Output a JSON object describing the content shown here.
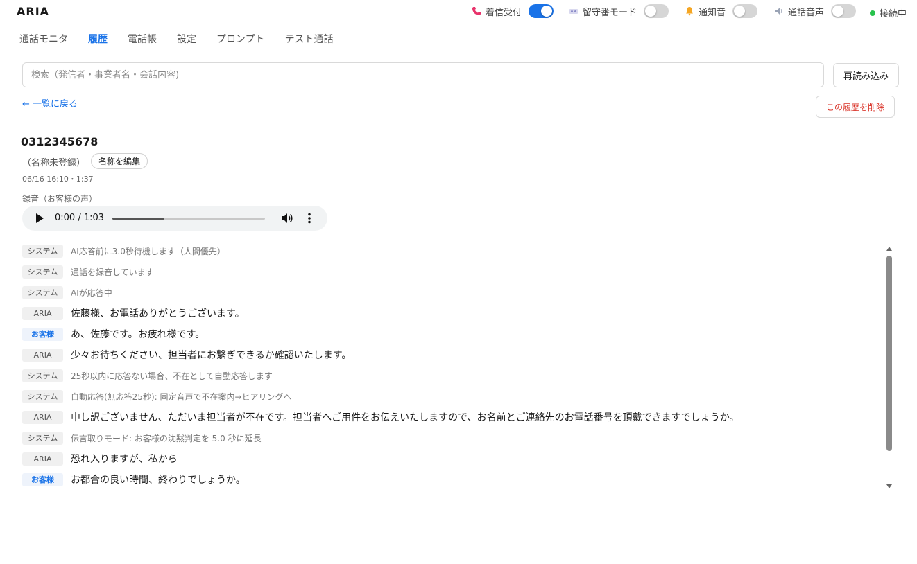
{
  "app": {
    "title": "ARIA"
  },
  "status": {
    "incoming": {
      "label": "着信受付",
      "on": true,
      "icon": "phone-icon",
      "color": "#e8336b"
    },
    "voicemail": {
      "label": "留守番モード",
      "on": false,
      "icon": "voicemail-icon"
    },
    "notify": {
      "label": "通知音",
      "on": false,
      "icon": "bell-icon",
      "color": "#f5a623"
    },
    "callaudio": {
      "label": "通話音声",
      "on": false,
      "icon": "speaker-icon"
    },
    "connection": {
      "label": "接続中",
      "color": "#27c24c"
    }
  },
  "tabs": [
    {
      "label": "通話モニタ",
      "active": false
    },
    {
      "label": "履歴",
      "active": true
    },
    {
      "label": "電話帳",
      "active": false
    },
    {
      "label": "設定",
      "active": false
    },
    {
      "label": "プロンプト",
      "active": false
    },
    {
      "label": "テスト通話",
      "active": false
    }
  ],
  "search": {
    "placeholder": "検索（発信者・事業者名・会話内容)",
    "value": ""
  },
  "buttons": {
    "reload": "再読み込み",
    "back": "← 一覧に戻る",
    "delete": "この履歴を削除",
    "edit_name": "名称を編集"
  },
  "call": {
    "number": "0312345678",
    "name": "（名称未登録）",
    "meta": "06/16 16:10・1:37",
    "recording_label": "録音（お客様の声）",
    "player": {
      "time": "0:00 / 1:03",
      "progress": 0.34
    }
  },
  "transcript": [
    {
      "speaker": "system",
      "badge": "システム",
      "text": "AI応答前に3.0秒待機します（人間優先）"
    },
    {
      "speaker": "system",
      "badge": "システム",
      "text": "通話を録音しています"
    },
    {
      "speaker": "system",
      "badge": "システム",
      "text": "AIが応答中"
    },
    {
      "speaker": "aria",
      "badge": "ARIA",
      "text": "佐藤様、お電話ありがとうございます。"
    },
    {
      "speaker": "customer",
      "badge": "お客様",
      "text": "あ、佐藤です。お疲れ様です。"
    },
    {
      "speaker": "aria",
      "badge": "ARIA",
      "text": "少々お待ちください、担当者にお繋ぎできるか確認いたします。"
    },
    {
      "speaker": "system",
      "badge": "システム",
      "text": "25秒以内に応答ない場合、不在として自動応答します"
    },
    {
      "speaker": "system",
      "badge": "システム",
      "text": "自動応答(無応答25秒): 固定音声で不在案内→ヒアリングへ"
    },
    {
      "speaker": "aria",
      "badge": "ARIA",
      "text": "申し訳ございません、ただいま担当者が不在です。担当者へご用件をお伝えいたしますので、お名前とご連絡先のお電話番号を頂戴できますでしょうか。"
    },
    {
      "speaker": "system",
      "badge": "システム",
      "text": "伝言取りモード: お客様の沈黙判定を 5.0 秒に延長"
    },
    {
      "speaker": "aria",
      "badge": "ARIA",
      "text": "恐れ入りますが、私から"
    },
    {
      "speaker": "customer",
      "badge": "お客様",
      "text": "お都合の良い時間、終わりでしょうか。"
    }
  ]
}
